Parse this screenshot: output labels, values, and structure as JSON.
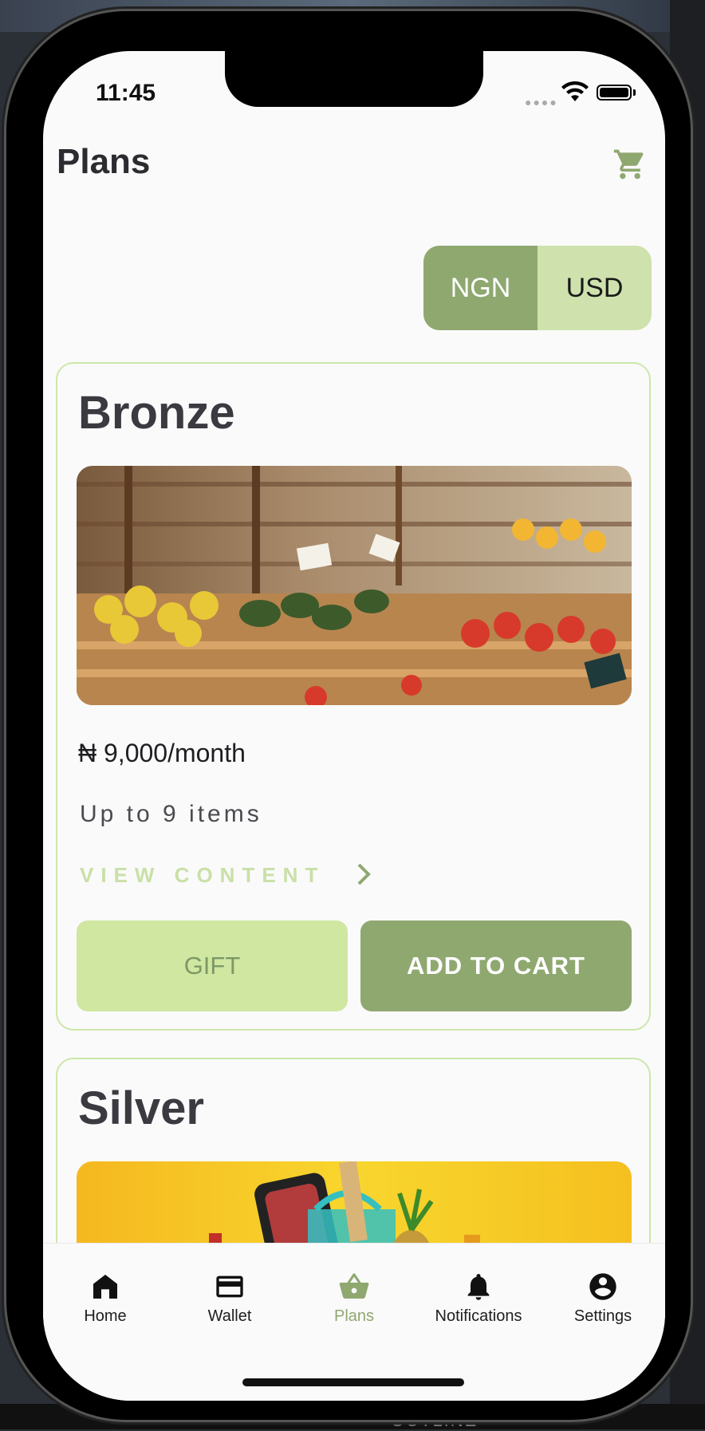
{
  "status_bar": {
    "time": "11:45"
  },
  "header": {
    "title": "Plans"
  },
  "currency_toggle": {
    "options": [
      "NGN",
      "USD"
    ],
    "selected": "NGN"
  },
  "plans": [
    {
      "name": "Bronze",
      "price": "₦ 9,000/month",
      "items": "Up to 9 items",
      "view_content": "VIEW CONTENT",
      "gift_label": "GIFT",
      "add_to_cart_label": "ADD TO CART"
    },
    {
      "name": "Silver"
    }
  ],
  "tab_bar": {
    "items": [
      {
        "label": "Home",
        "icon": "home-icon"
      },
      {
        "label": "Wallet",
        "icon": "wallet-icon"
      },
      {
        "label": "Plans",
        "icon": "basket-icon",
        "active": true
      },
      {
        "label": "Notifications",
        "icon": "bell-icon"
      },
      {
        "label": "Settings",
        "icon": "account-circle-icon"
      }
    ]
  },
  "colors": {
    "accent": "#8fa870",
    "accent_light": "#cfe2ad",
    "card_border": "#cde7a8",
    "gift_bg": "#cfe7a0",
    "view_content": "#c9e0a7"
  },
  "backdrop": {
    "bottom_text": "OUTLINE"
  }
}
